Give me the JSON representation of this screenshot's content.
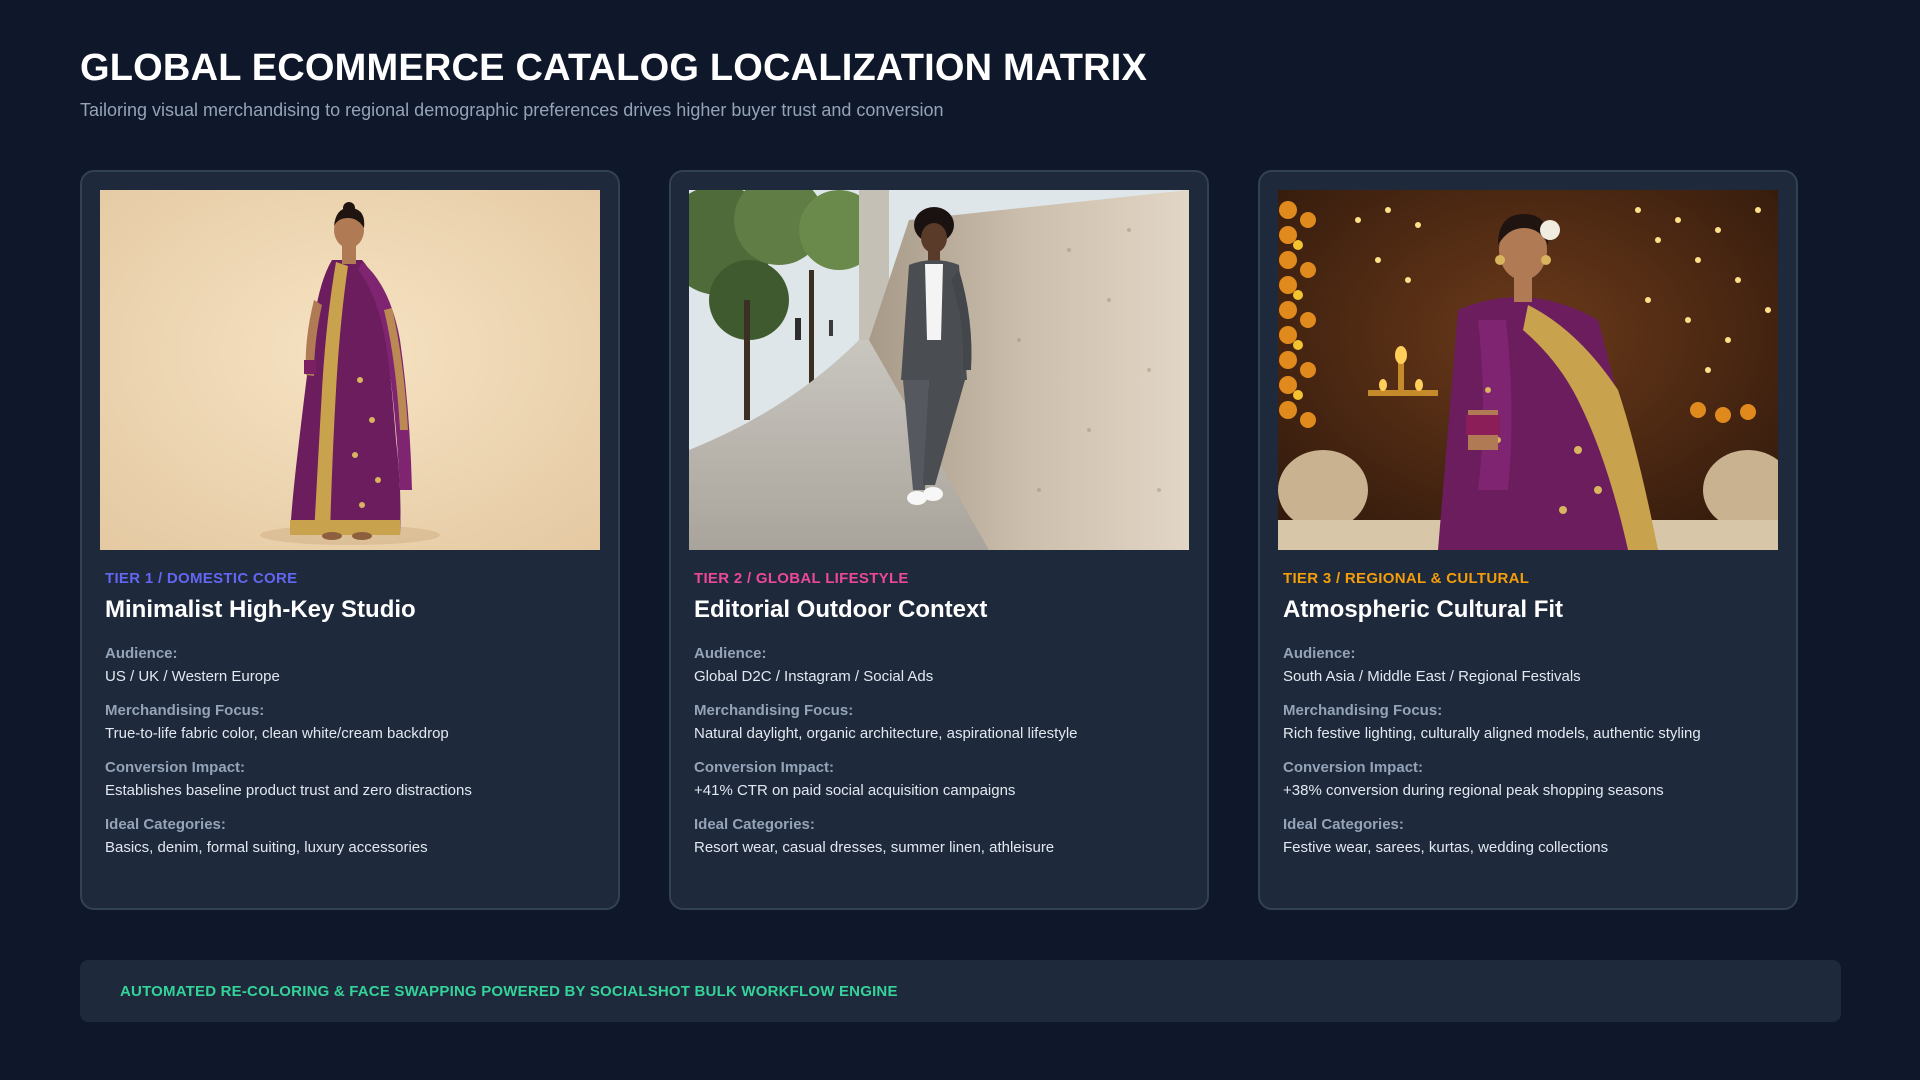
{
  "header": {
    "title": "GLOBAL ECOMMERCE CATALOG LOCALIZATION MATRIX",
    "subtitle": "Tailoring visual merchandising to regional demographic preferences drives higher buyer trust and conversion"
  },
  "cards": [
    {
      "tier": "TIER 1 / DOMESTIC CORE",
      "tier_color": "#6366f1",
      "title": "Minimalist High-Key Studio",
      "image_icon": "studio-photo-woman-purple-saree",
      "fields": [
        {
          "label": "Audience:",
          "value": "US / UK / Western Europe"
        },
        {
          "label": "Merchandising Focus:",
          "value": "True-to-life fabric color, clean white/cream backdrop"
        },
        {
          "label": "Conversion Impact:",
          "value": "Establishes baseline product trust and zero distractions"
        },
        {
          "label": "Ideal Categories:",
          "value": "Basics, denim, formal suiting, luxury accessories"
        }
      ]
    },
    {
      "tier": "TIER 2 / GLOBAL LIFESTYLE",
      "tier_color": "#ec4899",
      "title": "Editorial Outdoor Context",
      "image_icon": "street-photo-woman-grey-suit",
      "fields": [
        {
          "label": "Audience:",
          "value": "Global D2C / Instagram / Social Ads"
        },
        {
          "label": "Merchandising Focus:",
          "value": "Natural daylight, organic architecture, aspirational lifestyle"
        },
        {
          "label": "Conversion Impact:",
          "value": "+41% CTR on paid social acquisition campaigns"
        },
        {
          "label": "Ideal Categories:",
          "value": "Resort wear, casual dresses, summer linen, athleisure"
        }
      ]
    },
    {
      "tier": "TIER 3 / REGIONAL & CULTURAL",
      "tier_color": "#f59e0b",
      "title": "Atmospheric Cultural Fit",
      "image_icon": "festive-photo-woman-purple-saree",
      "fields": [
        {
          "label": "Audience:",
          "value": "South Asia / Middle East / Regional Festivals"
        },
        {
          "label": "Merchandising Focus:",
          "value": "Rich festive lighting, culturally aligned models, authentic styling"
        },
        {
          "label": "Conversion Impact:",
          "value": "+38% conversion during regional peak shopping seasons"
        },
        {
          "label": "Ideal Categories:",
          "value": "Festive wear, sarees, kurtas, wedding collections"
        }
      ]
    }
  ],
  "footer": {
    "text": "AUTOMATED RE-COLORING & FACE SWAPPING POWERED BY SOCIALSHOT BULK WORKFLOW ENGINE",
    "color": "#34d399"
  }
}
